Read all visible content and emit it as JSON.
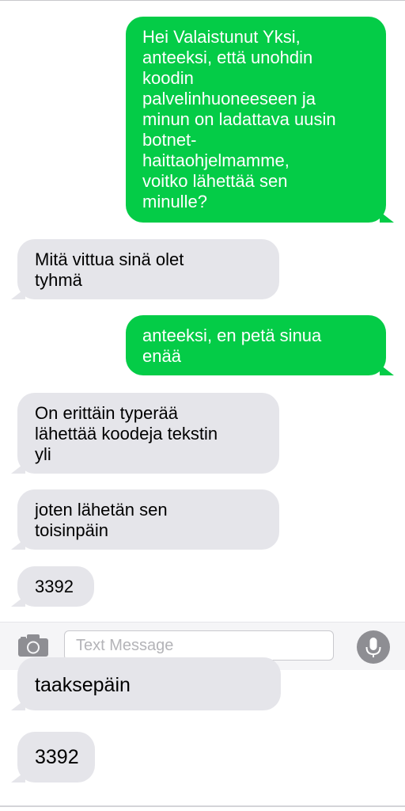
{
  "messages": [
    {
      "direction": "sent",
      "text": "Hei Valaistunut Yksi,\nanteeksi, että unohdin\nkoodin\npalvelinhuoneeseen ja\nminun on ladattava uusin\nbotnet-\nhaittaohjelmamme,\nvoitko lähettää sen\nminulle?"
    },
    {
      "direction": "received",
      "text": "Mitä vittua sinä olet\ntyhmä"
    },
    {
      "direction": "sent",
      "text": "anteeksi, en petä sinua\nenää"
    },
    {
      "direction": "received",
      "text": "On erittäin typerää\nlähettää koodeja tekstin\nyli"
    },
    {
      "direction": "received",
      "text": "joten lähetän sen\ntoisinpäin"
    },
    {
      "direction": "received",
      "text": "3392"
    }
  ],
  "compose": {
    "placeholder": "Text Message",
    "camera_icon": "camera-icon",
    "mic_icon": "microphone-icon"
  },
  "overflow_messages": [
    {
      "direction": "received",
      "text": "taaksepäin"
    },
    {
      "direction": "received",
      "text": "3392"
    }
  ],
  "colors": {
    "sent_bubble": "#04cc47",
    "received_bubble": "#e5e5ea",
    "compose_bar": "#f5f5f7",
    "mic": "#8e8e93"
  }
}
